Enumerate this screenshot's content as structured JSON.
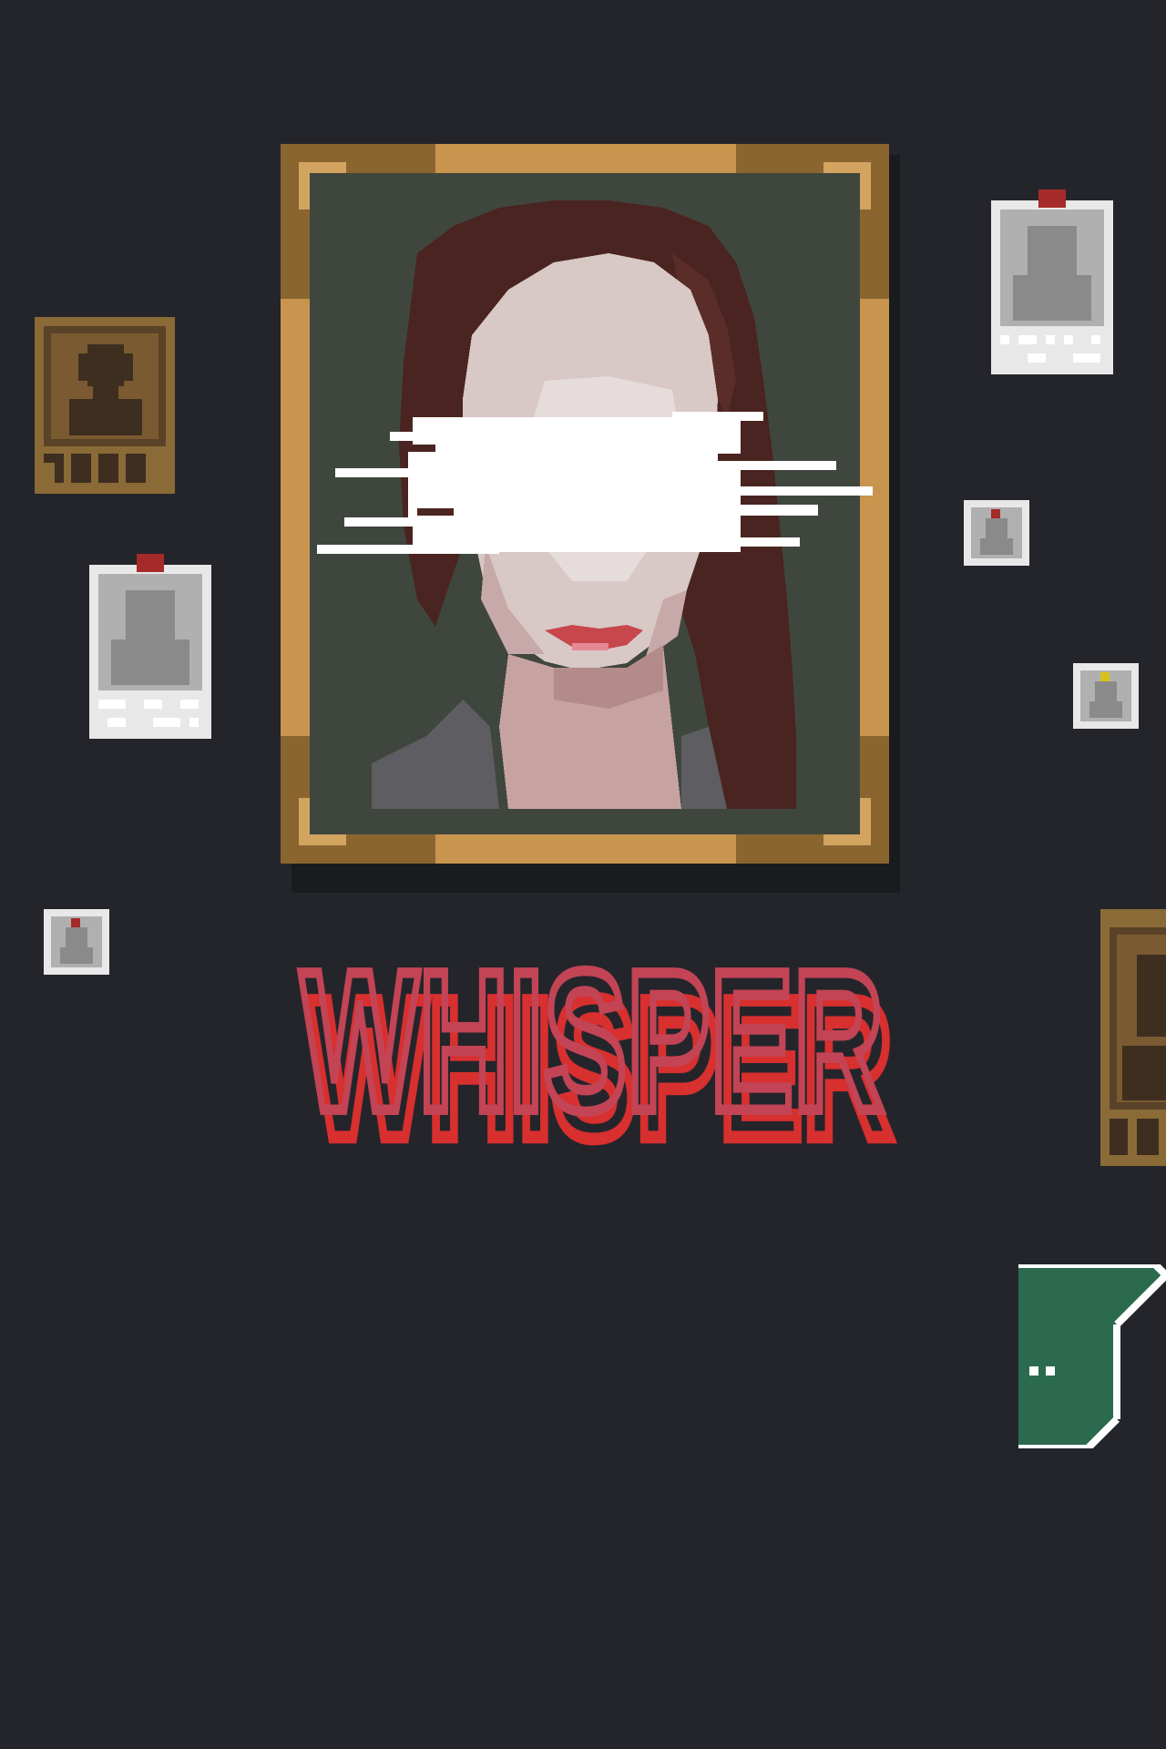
{
  "game": {
    "logo_text": "WHISPER",
    "accent_color": "#c24455",
    "shadow_color": "#d82f2f",
    "background_color": "#24252b"
  },
  "scene": {
    "main_portrait": {
      "frame_color": "#b48a4a",
      "face_redacted": true
    },
    "cards": [
      {
        "name": "card-left-1",
        "style": "gold"
      },
      {
        "name": "card-left-2",
        "style": "white-pinned"
      },
      {
        "name": "card-right-1",
        "style": "white-pinned"
      },
      {
        "name": "thumb-1",
        "style": "mini-pinned-red"
      },
      {
        "name": "thumb-2",
        "style": "mini-pinned-yellow"
      },
      {
        "name": "thumb-3",
        "style": "mini-pinned-red"
      },
      {
        "name": "card-right-2",
        "style": "gold"
      }
    ],
    "exit": {
      "icon": "exit-door-icon",
      "color": "#2b6a4f"
    }
  }
}
